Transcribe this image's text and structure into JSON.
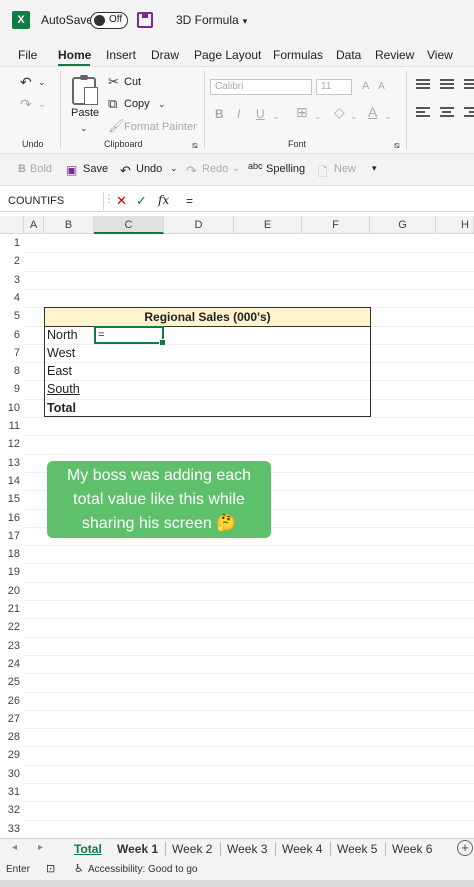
{
  "titlebar": {
    "app_icon": "X",
    "autosave_label": "AutoSave",
    "toggle_state": "Off",
    "doc_title": "3D Formula",
    "doc_caret": "▾",
    "save_icon": "save-icon"
  },
  "ribbon_tabs": [
    "File",
    "Home",
    "Insert",
    "Draw",
    "Page Layout",
    "Formulas",
    "Data",
    "Review",
    "View"
  ],
  "ribbon": {
    "undo_group_label": "Undo",
    "clipboard": {
      "paste": "Paste",
      "cut": "Cut",
      "copy": "Copy",
      "format_painter": "Format Painter",
      "label": "Clipboard"
    },
    "font": {
      "name": "Calibri",
      "size": "11",
      "label": "Font"
    }
  },
  "qat": {
    "bold": "Bold",
    "save": "Save",
    "undo": "Undo",
    "redo": "Redo",
    "spelling": "Spelling",
    "new": "New"
  },
  "formula_bar": {
    "name_box": "COUNTIFS",
    "content": "="
  },
  "columns": [
    "A",
    "B",
    "C",
    "D",
    "E",
    "F",
    "G",
    "H"
  ],
  "rows": [
    "1",
    "2",
    "3",
    "4",
    "5",
    "6",
    "7",
    "8",
    "9",
    "10",
    "11",
    "12",
    "13",
    "14",
    "15",
    "16",
    "17",
    "18",
    "19",
    "20",
    "21",
    "22",
    "23",
    "24",
    "25",
    "26",
    "27",
    "28",
    "29",
    "30",
    "31",
    "32",
    "33"
  ],
  "table": {
    "title": "Regional Sales (000's)",
    "rows": [
      "North",
      "West",
      "East",
      "South",
      "Total"
    ],
    "active_cell_value": "="
  },
  "caption": {
    "line1": "My boss was adding each",
    "line2": "total value like this while",
    "line3": "sharing his screen 🤔"
  },
  "sheets": [
    "Total",
    "Week 1",
    "Week 2",
    "Week 3",
    "Week 4",
    "Week 5",
    "Week 6"
  ],
  "active_sheet": "Total",
  "status": {
    "mode": "Enter",
    "accessibility": "Accessibility: Good to go"
  },
  "colors": {
    "excel_green": "#107c41",
    "title_fill": "#fff2cc",
    "caption_bg": "#5ec06b"
  }
}
